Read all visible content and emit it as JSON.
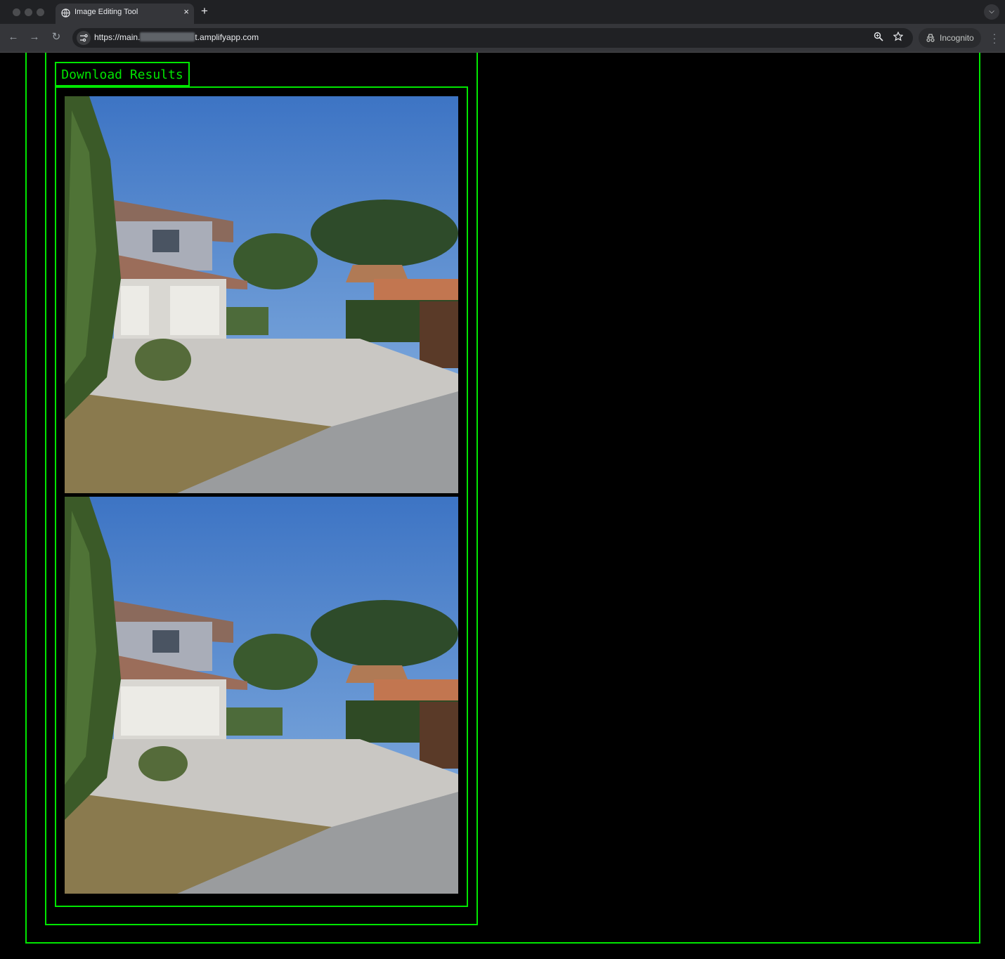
{
  "browser": {
    "tab_title": "Image Editing Tool",
    "tab_close": "×",
    "new_tab": "+",
    "url_prefix": "https://main.",
    "url_suffix": "t.amplifyapp.com",
    "profile_label": "Incognito"
  },
  "page": {
    "download_label": "Download Results",
    "accent_color": "#00e600",
    "images": [
      {
        "name": "result-image-1"
      },
      {
        "name": "result-image-2"
      }
    ]
  }
}
